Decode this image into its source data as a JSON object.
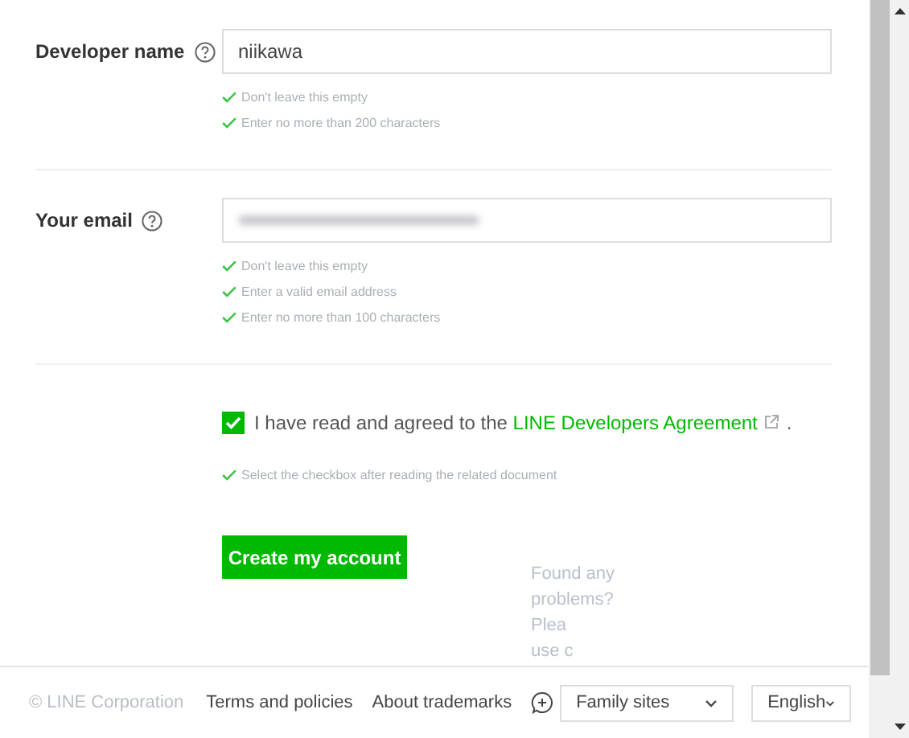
{
  "fields": [
    {
      "label": "Developer name",
      "value": "niikawa",
      "blurred": false,
      "rules": [
        {
          "text": "Don't leave this empty",
          "passed": true
        },
        {
          "text": "Enter no more than 200 characters",
          "passed": true
        }
      ]
    },
    {
      "label": "Your email",
      "blurred": true,
      "rules": [
        {
          "text": "Don't leave this empty",
          "passed": true
        },
        {
          "text": "Enter a valid email address",
          "passed": true
        },
        {
          "text": "Enter no more than 100 characters",
          "passed": true
        }
      ]
    }
  ],
  "agreement": {
    "checked": true,
    "text_before": "I have read and agreed to the",
    "link": "LINE Developers Agreement",
    "text_after": ".",
    "rule": {
      "text": "Select the checkbox after reading the related document",
      "passed": true
    }
  },
  "submit": "Create my account",
  "feedback": {
    "lines": [
      "Found any",
      "problems?",
      "Plea",
      "use c"
    ]
  },
  "footer": {
    "copyright": "© LINE Corporation",
    "links": [
      "Terms and policies",
      "About trademarks"
    ],
    "family": "Family sites",
    "language": "English"
  }
}
